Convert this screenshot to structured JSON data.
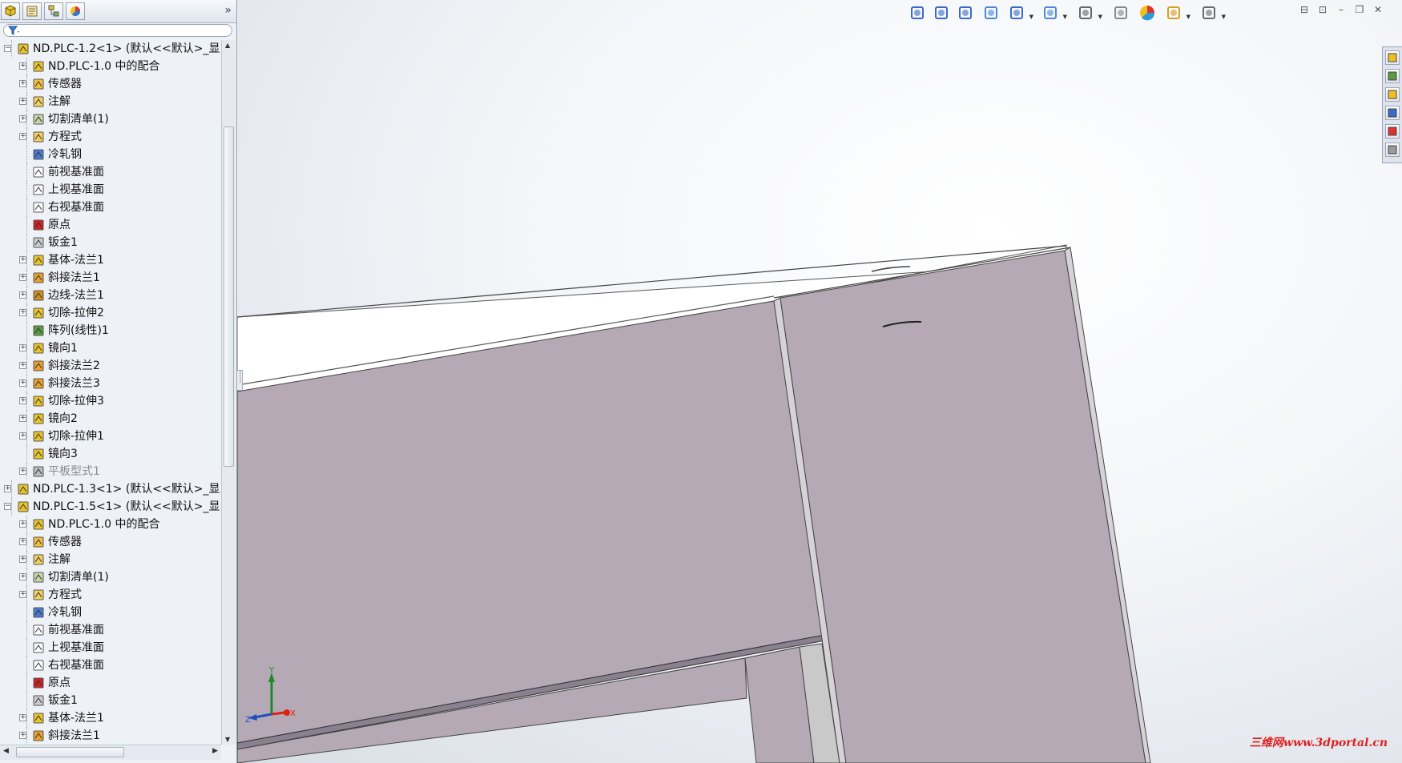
{
  "panel": {
    "tabs": [
      {
        "name": "feature-manager-tab",
        "icon": "feature-manager-icon"
      },
      {
        "name": "property-manager-tab",
        "icon": "property-manager-icon"
      },
      {
        "name": "configuration-manager-tab",
        "icon": "configuration-manager-icon"
      },
      {
        "name": "display-manager-tab",
        "icon": "display-manager-icon"
      }
    ],
    "expand_glyph": "»",
    "filter_icon": "filter-icon"
  },
  "tree": [
    {
      "label": "ND.PLC-1.2<1> (默认<<默认>_显",
      "level": 0,
      "exp": "−",
      "icon": "part-icon"
    },
    {
      "label": "ND.PLC-1.0 中的配合",
      "level": 1,
      "exp": "+",
      "icon": "mates-icon"
    },
    {
      "label": "传感器",
      "level": 1,
      "exp": "+",
      "icon": "sensor-icon"
    },
    {
      "label": "注解",
      "level": 1,
      "exp": "+",
      "icon": "annotation-icon"
    },
    {
      "label": "切割清单(1)",
      "level": 1,
      "exp": "+",
      "icon": "cut-list-icon"
    },
    {
      "label": "方程式",
      "level": 1,
      "exp": "+",
      "icon": "equation-icon"
    },
    {
      "label": "冷轧钢",
      "level": 1,
      "exp": "",
      "icon": "material-icon"
    },
    {
      "label": "前视基准面",
      "level": 1,
      "exp": "",
      "icon": "plane-icon"
    },
    {
      "label": "上视基准面",
      "level": 1,
      "exp": "",
      "icon": "plane-icon"
    },
    {
      "label": "右视基准面",
      "level": 1,
      "exp": "",
      "icon": "plane-icon"
    },
    {
      "label": "原点",
      "level": 1,
      "exp": "",
      "icon": "origin-icon"
    },
    {
      "label": "钣金1",
      "level": 1,
      "exp": "",
      "icon": "sheet-metal-icon"
    },
    {
      "label": "基体-法兰1",
      "level": 1,
      "exp": "+",
      "icon": "base-flange-icon"
    },
    {
      "label": "斜接法兰1",
      "level": 1,
      "exp": "+",
      "icon": "miter-flange-icon"
    },
    {
      "label": "边线-法兰1",
      "level": 1,
      "exp": "+",
      "icon": "edge-flange-icon"
    },
    {
      "label": "切除-拉伸2",
      "level": 1,
      "exp": "+",
      "icon": "cut-extrude-icon"
    },
    {
      "label": "阵列(线性)1",
      "level": 1,
      "exp": "",
      "icon": "linear-pattern-icon"
    },
    {
      "label": "镜向1",
      "level": 1,
      "exp": "+",
      "icon": "mirror-icon"
    },
    {
      "label": "斜接法兰2",
      "level": 1,
      "exp": "+",
      "icon": "miter-flange-icon"
    },
    {
      "label": "斜接法兰3",
      "level": 1,
      "exp": "+",
      "icon": "miter-flange-icon"
    },
    {
      "label": "切除-拉伸3",
      "level": 1,
      "exp": "+",
      "icon": "cut-extrude-icon"
    },
    {
      "label": "镜向2",
      "level": 1,
      "exp": "+",
      "icon": "mirror-icon"
    },
    {
      "label": "切除-拉伸1",
      "level": 1,
      "exp": "+",
      "icon": "cut-extrude-icon"
    },
    {
      "label": "镜向3",
      "level": 1,
      "exp": "",
      "icon": "mirror-icon"
    },
    {
      "label": "平板型式1",
      "level": 1,
      "exp": "+",
      "icon": "flat-pattern-icon",
      "dim": true
    },
    {
      "label": "ND.PLC-1.3<1> (默认<<默认>_显",
      "level": 0,
      "exp": "+",
      "icon": "part-icon"
    },
    {
      "label": "ND.PLC-1.5<1> (默认<<默认>_显",
      "level": 0,
      "exp": "−",
      "icon": "part-icon"
    },
    {
      "label": "ND.PLC-1.0 中的配合",
      "level": 1,
      "exp": "+",
      "icon": "mates-icon"
    },
    {
      "label": "传感器",
      "level": 1,
      "exp": "+",
      "icon": "sensor-icon"
    },
    {
      "label": "注解",
      "level": 1,
      "exp": "+",
      "icon": "annotation-icon"
    },
    {
      "label": "切割清单(1)",
      "level": 1,
      "exp": "+",
      "icon": "cut-list-icon"
    },
    {
      "label": "方程式",
      "level": 1,
      "exp": "+",
      "icon": "equation-icon"
    },
    {
      "label": "冷轧钢",
      "level": 1,
      "exp": "",
      "icon": "material-icon"
    },
    {
      "label": "前视基准面",
      "level": 1,
      "exp": "",
      "icon": "plane-icon"
    },
    {
      "label": "上视基准面",
      "level": 1,
      "exp": "",
      "icon": "plane-icon"
    },
    {
      "label": "右视基准面",
      "level": 1,
      "exp": "",
      "icon": "plane-icon"
    },
    {
      "label": "原点",
      "level": 1,
      "exp": "",
      "icon": "origin-icon"
    },
    {
      "label": "钣金1",
      "level": 1,
      "exp": "",
      "icon": "sheet-metal-icon"
    },
    {
      "label": "基体-法兰1",
      "level": 1,
      "exp": "+",
      "icon": "base-flange-icon"
    },
    {
      "label": "斜接法兰1",
      "level": 1,
      "exp": "+",
      "icon": "miter-flange-icon"
    }
  ],
  "view_toolbar": [
    {
      "name": "zoom-to-fit-icon"
    },
    {
      "name": "zoom-to-area-icon"
    },
    {
      "name": "previous-view-icon"
    },
    {
      "name": "section-view-icon"
    },
    {
      "name": "dynamic-annotation-icon"
    },
    {
      "name": "view-orientation-icon"
    },
    {
      "name": "display-style-icon"
    },
    {
      "name": "hide-show-items-icon"
    },
    {
      "name": "edit-appearance-icon"
    },
    {
      "name": "apply-scene-icon"
    },
    {
      "name": "view-settings-icon"
    }
  ],
  "window_controls": [
    "tile-horizontal-icon",
    "tile-vertical-icon",
    "minimize-icon",
    "restore-icon",
    "close-icon"
  ],
  "task_pane": [
    "home-icon",
    "design-library-icon",
    "file-explorer-icon",
    "view-palette-icon",
    "appearances-icon",
    "custom-properties-icon"
  ],
  "triad": {
    "y": "Y",
    "z": "Z",
    "x": "X"
  },
  "colors": {
    "panel_face": "#b4a9b4",
    "panel_top": "#ffffff",
    "accent_red": "#dd2222"
  },
  "watermark": "三维网www.3dportal.cn"
}
